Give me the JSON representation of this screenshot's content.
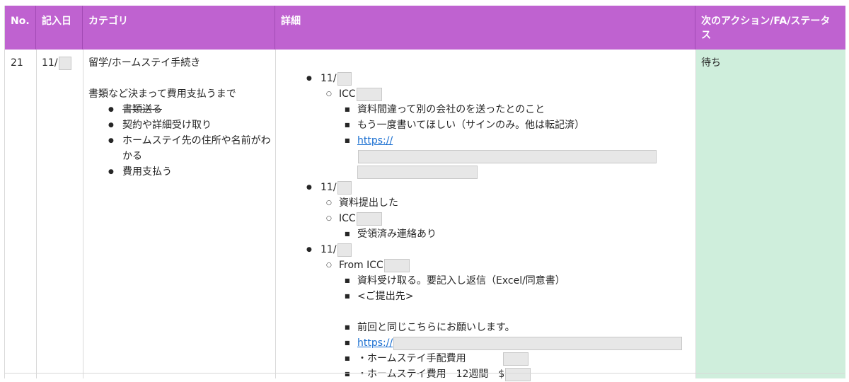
{
  "headers": [
    "No.",
    "記入日",
    "カテゴリ",
    "詳細",
    "次のアクション/FA/ステータス"
  ],
  "row": {
    "no": "21",
    "date": "11/",
    "category": {
      "title": "留学/ホームステイ手続き",
      "intro": "書類など決まって費用支払うまで",
      "items": [
        "書類送る",
        "契約や詳細受け取り",
        "ホームステイ先の住所や名前がわかる",
        "費用支払う"
      ]
    },
    "details": {
      "entry1": {
        "date": "11/",
        "sub": "ICC",
        "items": [
          "資料間違って別の会社のを送ったとのこと",
          "もう一度書いてほしい（サインのみ。他は転記済）"
        ],
        "link": "https://"
      },
      "entry2": {
        "date": "11/",
        "sub1": "資料提出した",
        "sub2": "ICC",
        "items": [
          "受領済み連絡あり"
        ]
      },
      "entry3": {
        "date": "11/",
        "sub": "From ICC",
        "items": [
          "資料受け取る。要記入し返信（Excel/同意書）",
          "<ご提出先>",
          "前回と同じこちらにお願いします。"
        ],
        "link": "https://",
        "fee1": "・ホームステイ手配費用",
        "fee2": "・ホームステイ費用　12週間　$"
      }
    },
    "status": "待ち"
  },
  "colors": {
    "header": "#bf62d0",
    "status": "#cfeedc",
    "link": "#1a6fd1"
  }
}
